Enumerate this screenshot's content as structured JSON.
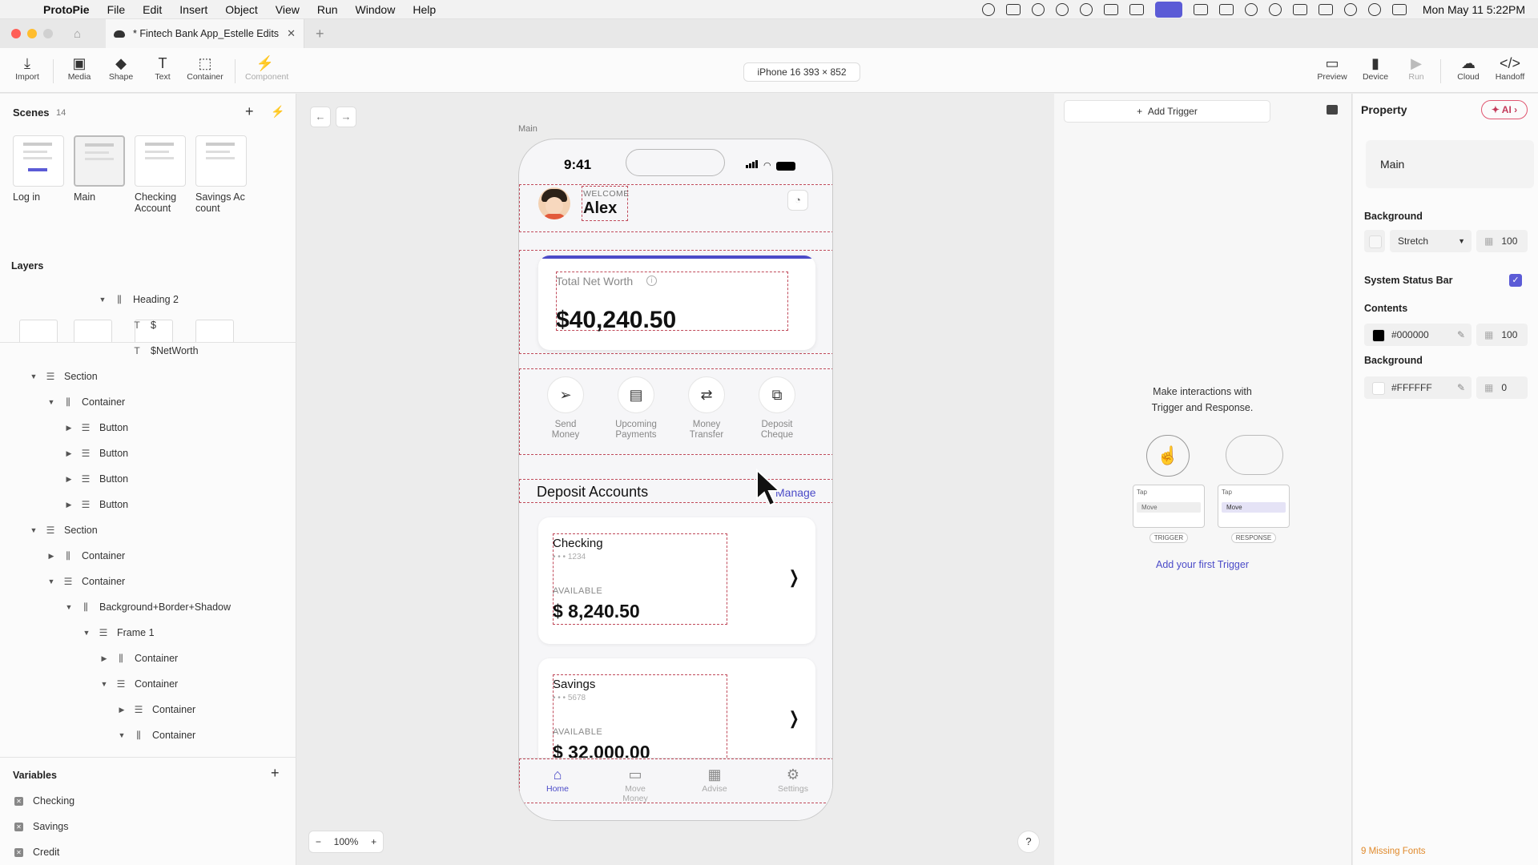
{
  "menubar": {
    "app_name": "ProtoPie",
    "items": [
      "File",
      "Edit",
      "Insert",
      "Object",
      "View",
      "Run",
      "Window",
      "Help"
    ],
    "clock": "Mon May 11  5:22PM"
  },
  "tab": {
    "title": "* Fintech Bank App_Estelle Edits"
  },
  "toolbar": {
    "tools": [
      {
        "label": "Import",
        "icon": "import-icon"
      },
      {
        "label": "Media",
        "icon": "media-icon"
      },
      {
        "label": "Shape",
        "icon": "shape-icon"
      },
      {
        "label": "Text",
        "icon": "text-icon"
      },
      {
        "label": "Container",
        "icon": "container-icon"
      },
      {
        "label": "Component",
        "icon": "component-icon"
      }
    ],
    "device": "iPhone 16  393 × 852",
    "right_tools": [
      {
        "label": "Preview",
        "icon": "preview-icon"
      },
      {
        "label": "Device",
        "icon": "device-icon"
      },
      {
        "label": "Run",
        "icon": "run-icon"
      },
      {
        "label": "Cloud",
        "icon": "cloud-icon"
      },
      {
        "label": "Handoff",
        "icon": "handoff-icon"
      }
    ]
  },
  "scenes": {
    "title": "Scenes",
    "count": "14",
    "items": [
      "Log in",
      "Main",
      "Checking\nAccount",
      "Savings Ac\ncount"
    ]
  },
  "layers": {
    "title": "Layers",
    "items": [
      {
        "name": "Heading 2",
        "icon": "column-layout-icon"
      },
      {
        "name": "$",
        "icon": "text-icon"
      },
      {
        "name": "$NetWorth",
        "icon": "text-icon"
      },
      {
        "name": "Section",
        "icon": "row-layout-icon"
      },
      {
        "name": "Container",
        "icon": "column-layout-icon"
      },
      {
        "name": "Button",
        "icon": "row-layout-icon"
      },
      {
        "name": "Button",
        "icon": "row-layout-icon"
      },
      {
        "name": "Button",
        "icon": "row-layout-icon"
      },
      {
        "name": "Button",
        "icon": "row-layout-icon"
      },
      {
        "name": "Section",
        "icon": "row-layout-icon"
      },
      {
        "name": "Container",
        "icon": "column-layout-icon"
      },
      {
        "name": "Container",
        "icon": "row-layout-icon"
      },
      {
        "name": "Background+Border+Shadow",
        "icon": "column-layout-icon"
      },
      {
        "name": "Frame 1",
        "icon": "row-layout-icon"
      },
      {
        "name": "Container",
        "icon": "column-layout-icon"
      },
      {
        "name": "Container",
        "icon": "row-layout-icon"
      },
      {
        "name": "Container",
        "icon": "row-layout-icon"
      },
      {
        "name": "Container",
        "icon": "column-layout-icon"
      }
    ]
  },
  "variables": {
    "title": "Variables",
    "items": [
      "Checking",
      "Savings",
      "Credit"
    ]
  },
  "canvas": {
    "frame_label": "Main",
    "zoom": "100%",
    "help": "?"
  },
  "phone": {
    "time": "9:41",
    "welcome": "WELCOME",
    "user": "Alex",
    "net_worth_label": "Total Net Worth",
    "net_worth": "$40,240.50",
    "actions": [
      {
        "label": "Send\nMoney",
        "icon": "send-icon"
      },
      {
        "label": "Upcoming\nPayments",
        "icon": "receipt-icon"
      },
      {
        "label": "Money\nTransfer",
        "icon": "transfer-icon"
      },
      {
        "label": "Deposit\nCheque",
        "icon": "scan-icon"
      }
    ],
    "section_title": "Deposit Accounts",
    "manage": "Manage",
    "accounts": [
      {
        "name": "Checking",
        "number": "• • • 1234",
        "available": "AVAILABLE",
        "balance": "$ 8,240.50"
      },
      {
        "name": "Savings",
        "number": "• • • 5678",
        "available": "AVAILABLE",
        "balance": "$ 32,000.00"
      }
    ],
    "nav": [
      {
        "label": "Home",
        "icon": "home-icon"
      },
      {
        "label": "Move Money",
        "icon": "money-icon"
      },
      {
        "label": "Advise",
        "icon": "chart-icon"
      },
      {
        "label": "Settings",
        "icon": "gear-icon"
      }
    ]
  },
  "trigger_panel": {
    "add_trigger": "Add Trigger",
    "make_interactions": "Make interactions with\nTrigger and Response.",
    "trigger_card": {
      "label": "TRIGGER",
      "row1": "Tap",
      "row2": "Move"
    },
    "response_card": {
      "label": "RESPONSE",
      "row1": "Tap",
      "row2": "Move"
    },
    "first_trigger": "Add your first Trigger"
  },
  "property_panel": {
    "title": "Property",
    "ai": "AI",
    "scene_name": "Main",
    "background_label": "Background",
    "stretch": "Stretch",
    "stretch_opacity": "100",
    "status_bar_label": "System Status Bar",
    "contents_label": "Contents",
    "contents_color": "#000000",
    "contents_opacity": "100",
    "bg2_label": "Background",
    "bg2_color": "#FFFFFF",
    "bg2_opacity": "0",
    "missing_fonts": "9 Missing Fonts"
  },
  "colors": {
    "accent": "#5b5bd6",
    "guide": "#c04a5a",
    "brand": "#4b4bc8"
  }
}
